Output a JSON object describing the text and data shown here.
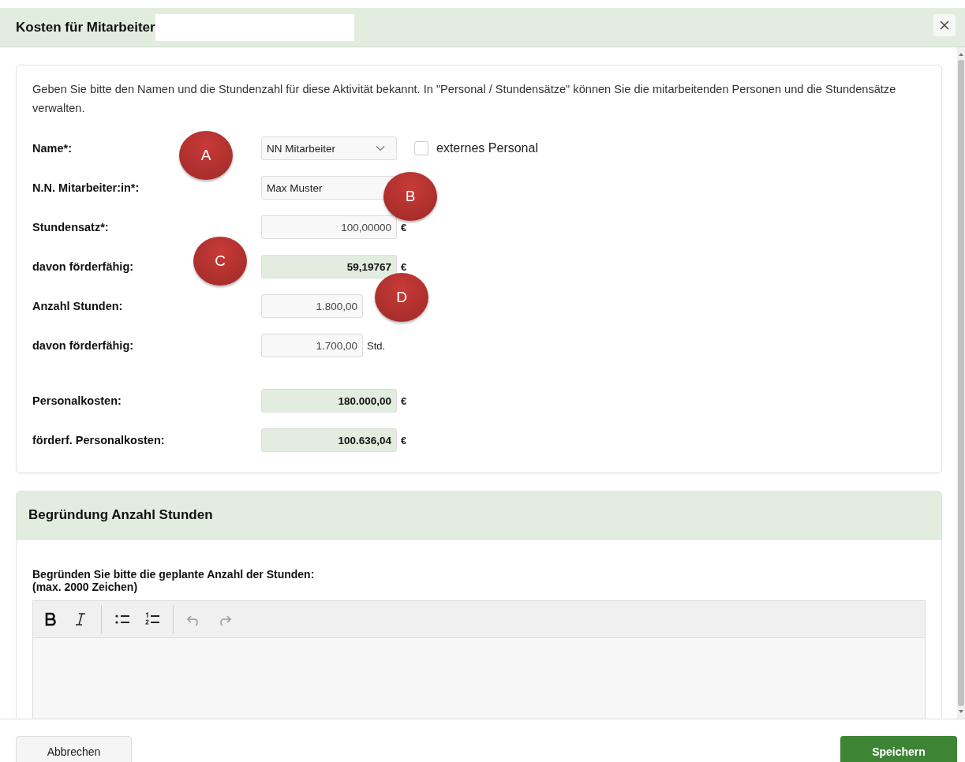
{
  "dialog": {
    "title": "Kosten für Mitarbeiter",
    "title_redacted": true
  },
  "intro": "Geben Sie bitte den Namen und die Stundenzahl für diese Aktivität bekannt. In \"Personal / Stundensätze\" können Sie die mitarbeitenden Personen und die Stundensätze verwalten.",
  "form_rows": [
    {
      "label": "Name*:",
      "kind": "select",
      "value": "NN Mitarbeiter",
      "checkbox": {
        "label": "externes Personal",
        "checked": false
      }
    },
    {
      "label": "N.N. Mitarbeiter:in*:",
      "kind": "text",
      "value": "Max Muster"
    },
    {
      "label": "Stundensatz*:",
      "kind": "number",
      "value": "100,00000",
      "unit": "€"
    },
    {
      "label": "davon förderfähig:",
      "kind": "computed",
      "value": "59,19767",
      "unit": "€"
    },
    {
      "label": "Anzahl Stunden:",
      "kind": "hours",
      "value": "1.800,00"
    },
    {
      "label": "davon förderfähig:",
      "kind": "hours",
      "value": "1.700,00",
      "unit": "Std."
    }
  ],
  "total_rows": [
    {
      "label": "Personalkosten:",
      "kind": "computed",
      "value": "180.000,00",
      "unit": "€"
    },
    {
      "label": "förderf. Personalkosten:",
      "kind": "computed",
      "value": "100.636,04",
      "unit": "€"
    }
  ],
  "markers": [
    {
      "label": "A"
    },
    {
      "label": "B"
    },
    {
      "label": "C"
    },
    {
      "label": "D"
    }
  ],
  "justification": {
    "heading": "Begründung Anzahl Stunden",
    "prompt": "Begründen Sie bitte die geplante Anzahl der Stunden:",
    "limit": "(max. 2000 Zeichen)"
  },
  "footer": {
    "cancel": "Abbrechen",
    "save": "Speichern"
  }
}
